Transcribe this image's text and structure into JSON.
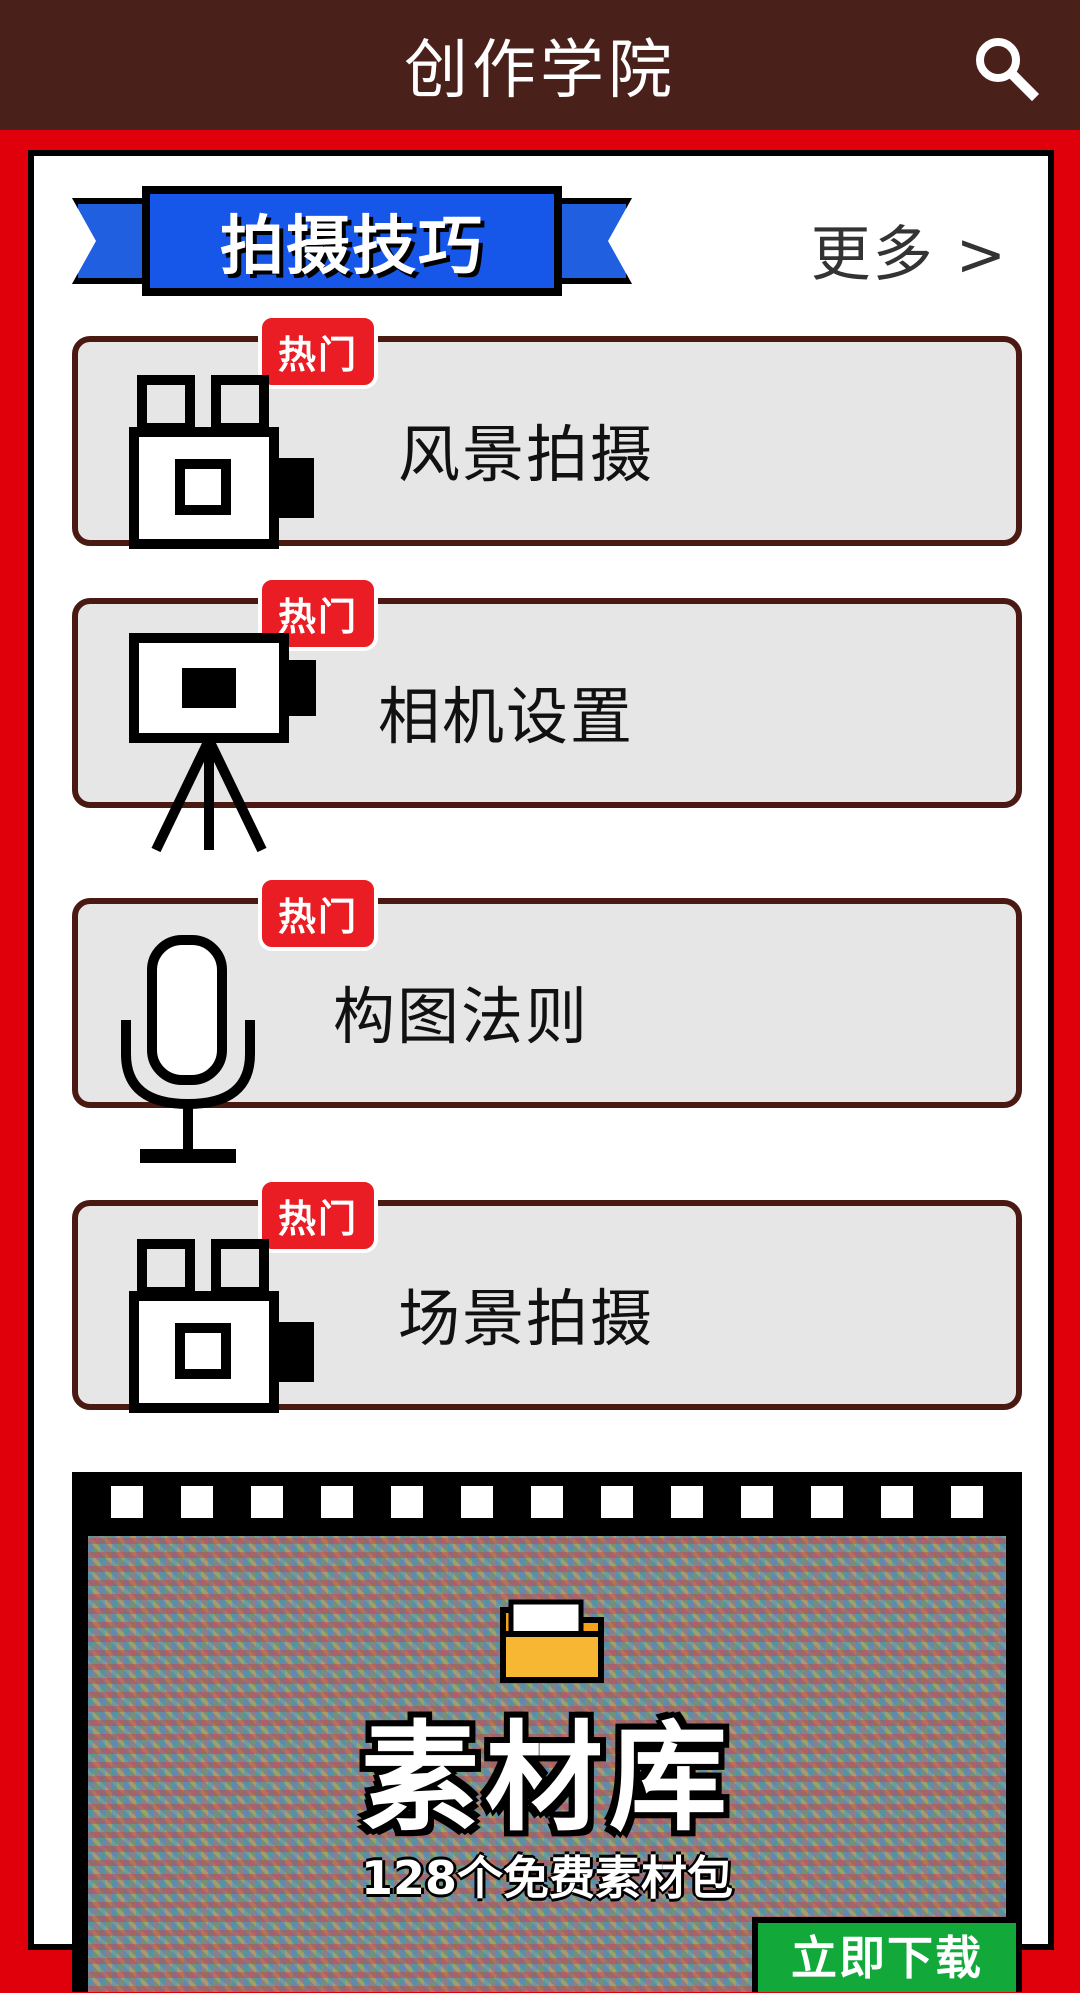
{
  "header": {
    "title": "创作学院",
    "search_icon": "search-icon"
  },
  "section": {
    "title": "拍摄技巧",
    "more_label": "更多 >"
  },
  "cards": [
    {
      "label": "风景拍摄",
      "badge": "热门",
      "icon": "camera-icon"
    },
    {
      "label": "相机设置",
      "badge": "热门",
      "icon": "tripod-camera-icon"
    },
    {
      "label": "构图法则",
      "badge": "热门",
      "icon": "microphone-icon"
    },
    {
      "label": "场景拍摄",
      "badge": "热门",
      "icon": "camera-icon"
    }
  ],
  "banner": {
    "title": "素材库",
    "subtitle": "128个免费素材包",
    "button_label": "立即下载",
    "icon": "folder-icon"
  },
  "colors": {
    "header_bg": "#4a201b",
    "frame_red": "#e0000c",
    "ribbon_blue": "#1656e8",
    "badge_red": "#ea1c24",
    "download_green": "#12a83a"
  }
}
